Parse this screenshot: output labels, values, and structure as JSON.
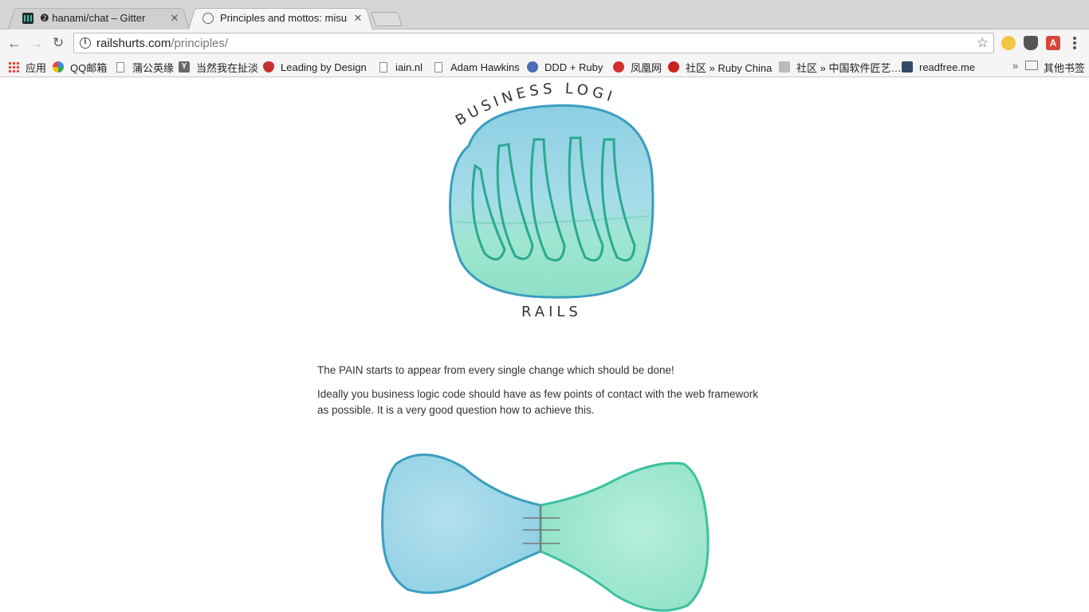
{
  "browser": {
    "tabs": [
      {
        "title": "❷ hanami/chat – Gitter",
        "close": "✕",
        "favicon": "gitter-icon",
        "active": false
      },
      {
        "title": "Principles and mottos: misunderstood",
        "close": "✕",
        "favicon": "railshurts-icon",
        "active": true
      }
    ],
    "url": {
      "host": "railshurts.com",
      "path": "/principles/"
    },
    "bookmarks": [
      {
        "label": "应用",
        "icon": "apps-grid-icon"
      },
      {
        "label": "QQ邮箱",
        "icon": "qq-mail-icon"
      },
      {
        "label": "蒲公英缘",
        "icon": "page-icon"
      },
      {
        "label": "当然我在扯淡",
        "icon": "y-icon"
      },
      {
        "label": "Leading by Design",
        "icon": "lbd-icon"
      },
      {
        "label": "iain.nl",
        "icon": "page-icon"
      },
      {
        "label": "Adam Hawkins",
        "icon": "page-icon"
      },
      {
        "label": "DDD + Ruby",
        "icon": "ddd-icon"
      },
      {
        "label": "凤凰网",
        "icon": "ifeng-icon"
      },
      {
        "label": "社区 » Ruby China",
        "icon": "ruby-china-icon"
      },
      {
        "label": "社区 » 中国软件匠艺…",
        "icon": "software-craft-icon"
      },
      {
        "label": "readfree.me",
        "icon": "readfree-icon"
      }
    ],
    "bookmarks_overflow": "»",
    "other_bookmarks": "其他书签"
  },
  "page": {
    "illustration_top": {
      "label_top": "BUSINESS LOGIC",
      "label_bottom": "RAILS"
    },
    "paragraphs": [
      "The PAIN starts to appear from every single change which should be done!",
      "Ideally you business logic code should have as few points of contact with the web framework as possible. It is a very good question how to achieve this."
    ]
  },
  "colors": {
    "blue": "#8dcfe3",
    "blue_stroke": "#3a9ec0",
    "green": "#8ee0c6",
    "green_stroke": "#3cc0a0"
  }
}
